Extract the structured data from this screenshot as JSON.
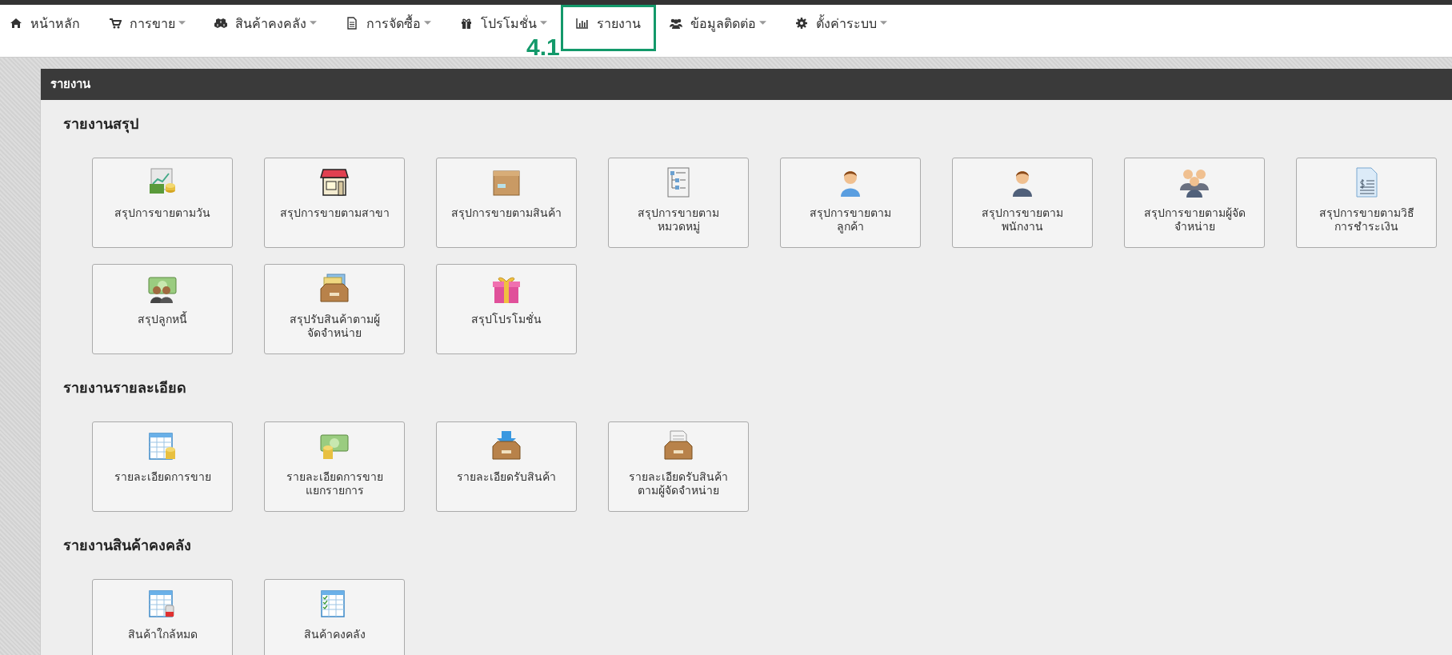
{
  "nav": {
    "items": [
      {
        "label": "หน้าหลัก",
        "dropdown": false,
        "callout": false
      },
      {
        "label": "การขาย",
        "dropdown": true,
        "callout": false
      },
      {
        "label": "สินค้าคงคลัง",
        "dropdown": true,
        "callout": false
      },
      {
        "label": "การจัดซื้อ",
        "dropdown": true,
        "callout": false
      },
      {
        "label": "โปรโมชั่น",
        "dropdown": true,
        "callout": false
      },
      {
        "label": "รายงาน",
        "dropdown": false,
        "callout": true
      },
      {
        "label": "ข้อมูลติดต่อ",
        "dropdown": true,
        "callout": false
      },
      {
        "label": "ตั้งค่าระบบ",
        "dropdown": true,
        "callout": false
      }
    ],
    "callout_label": "4.1"
  },
  "panel": {
    "title": "รายงาน",
    "sections": [
      {
        "title": "รายงานสรุป",
        "tiles": [
          "สรุปการขายตามวัน",
          "สรุปการขายตามสาขา",
          "สรุปการขายตามสินค้า",
          "สรุปการขายตาม\nหมวดหมู่",
          "สรุปการขายตาม\nลูกค้า",
          "สรุปการขายตาม\nพนักงาน",
          "สรุปการขายตามผู้จัด\nจำหน่าย",
          "สรุปการขายตามวิธี\nการชำระเงิน",
          "สรุปลูกหนี้",
          "สรุปรับสินค้าตามผู้\nจัดจำหน่าย",
          "สรุปโปรโมชั่น"
        ]
      },
      {
        "title": "รายงานรายละเอียด",
        "tiles": [
          "รายละเอียดการขาย",
          "รายละเอียดการขาย\nแยกรายการ",
          "รายละเอียดรับสินค้า",
          "รายละเอียดรับสินค้า\nตามผู้จัดจำหน่าย"
        ]
      },
      {
        "title": "รายงานสินค้าคงคลัง",
        "tiles": [
          "สินค้าใกล้หมด",
          "สินค้าคงคลัง"
        ]
      }
    ]
  }
}
